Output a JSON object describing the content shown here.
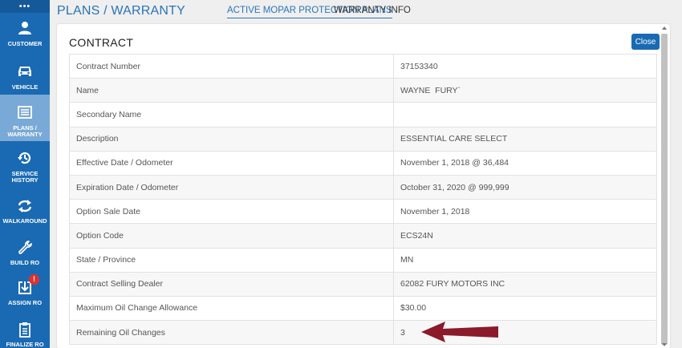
{
  "sidebar": {
    "menu_dots": "•••",
    "items": [
      {
        "label": "CUSTOMER",
        "icon": "person-icon"
      },
      {
        "label": "VEHICLE",
        "icon": "car-icon"
      },
      {
        "label": "PLANS /\nWARRANTY",
        "icon": "list-icon",
        "active": true
      },
      {
        "label": "SERVICE\nHISTORY",
        "icon": "history-icon"
      },
      {
        "label": "WALKAROUND",
        "icon": "refresh-icon"
      },
      {
        "label": "BUILD RO",
        "icon": "wrench-icon"
      },
      {
        "label": "ASSIGN RO",
        "icon": "assign-icon",
        "badge": "!"
      },
      {
        "label": "FINALIZE RO",
        "icon": "clipboard-icon"
      }
    ]
  },
  "header": {
    "title": "PLANS / WARRANTY",
    "tabs": [
      {
        "label": "ACTIVE MOPAR PROTECTION PLANS",
        "active": true
      },
      {
        "label": "WARRANTY INFO",
        "active": false
      }
    ]
  },
  "panel": {
    "title": "CONTRACT",
    "close_label": "Close",
    "rows": [
      {
        "label": "Contract Number",
        "value": "37153340"
      },
      {
        "label": "Name",
        "value": "WAYNE  FURY`"
      },
      {
        "label": "Secondary Name",
        "value": ""
      },
      {
        "label": "Description",
        "value": "ESSENTIAL CARE SELECT"
      },
      {
        "label": "Effective Date / Odometer",
        "value": "November 1, 2018 @ 36,484"
      },
      {
        "label": "Expiration Date / Odometer",
        "value": "October 31, 2020 @ 999,999"
      },
      {
        "label": "Option Sale Date",
        "value": "November 1, 2018"
      },
      {
        "label": "Option Code",
        "value": "ECS24N"
      },
      {
        "label": "State / Province",
        "value": "MN"
      },
      {
        "label": "Contract Selling Dealer",
        "value": "62082 FURY MOTORS INC"
      },
      {
        "label": "Maximum Oil Change Allowance",
        "value": "$30.00"
      },
      {
        "label": "Remaining Oil Changes",
        "value": "3"
      }
    ]
  },
  "colors": {
    "sidebar_bg": "#1a6ab3",
    "sidebar_active": "#79a9d6",
    "accent": "#2a74b8",
    "badge": "#e0312f",
    "annotation_arrow": "#8b1a2b"
  }
}
